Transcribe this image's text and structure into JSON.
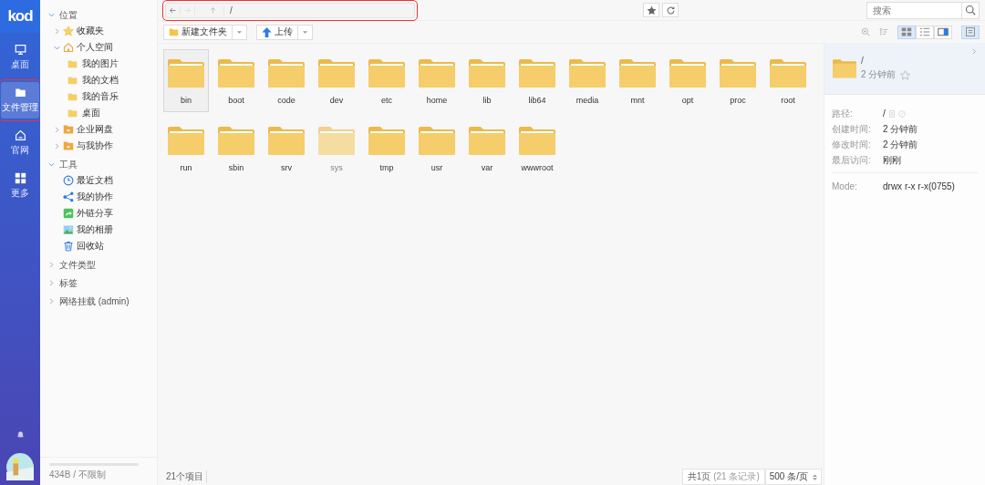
{
  "rail": {
    "logo": "kod",
    "items": [
      {
        "kind": "desktop",
        "label": "桌面",
        "selected": false,
        "highlighted": false
      },
      {
        "kind": "folder",
        "label": "文件管理",
        "selected": true,
        "highlighted": true
      },
      {
        "kind": "home",
        "label": "官网",
        "selected": false,
        "highlighted": false
      },
      {
        "kind": "grid",
        "label": "更多",
        "selected": false,
        "highlighted": false
      }
    ]
  },
  "tree": {
    "sections": [
      {
        "label": "位置",
        "expanded": true,
        "children": [
          {
            "kind": "star",
            "label": "收藏夹",
            "expanded": false
          },
          {
            "kind": "home",
            "label": "个人空间",
            "expanded": true,
            "children": [
              {
                "kind": "folder",
                "label": "我的图片"
              },
              {
                "kind": "folder",
                "label": "我的文档"
              },
              {
                "kind": "folder",
                "label": "我的音乐"
              },
              {
                "kind": "folder",
                "label": "桌面"
              }
            ]
          },
          {
            "kind": "company",
            "label": "企业网盘",
            "expanded": false
          },
          {
            "kind": "shared",
            "label": "与我协作",
            "expanded": false
          }
        ]
      },
      {
        "label": "工具",
        "expanded": true,
        "children": [
          {
            "kind": "clock",
            "label": "最近文档"
          },
          {
            "kind": "share",
            "label": "我的协作"
          },
          {
            "kind": "link",
            "label": "外链分享"
          },
          {
            "kind": "image",
            "label": "我的相册"
          },
          {
            "kind": "trash",
            "label": "回收站"
          }
        ]
      },
      {
        "label": "文件类型",
        "expanded": false
      },
      {
        "label": "标签",
        "expanded": false
      },
      {
        "label": "网络挂载 (admin)",
        "expanded": false
      }
    ],
    "storage": {
      "text": "434B / 不限制",
      "level": 0
    }
  },
  "address_bar": {
    "path": "/",
    "highlighted": true,
    "forward_disabled": true
  },
  "search": {
    "placeholder": "搜索"
  },
  "toolbar": {
    "new_folder": "新建文件夹",
    "upload": "上传",
    "views": [
      {
        "kind": "grid",
        "selected": true
      },
      {
        "kind": "list",
        "selected": false
      },
      {
        "kind": "split",
        "selected": false
      }
    ],
    "panel_open": true
  },
  "files": [
    {
      "name": "bin",
      "selected": true,
      "hidden": false
    },
    {
      "name": "boot",
      "selected": false,
      "hidden": false
    },
    {
      "name": "code",
      "selected": false,
      "hidden": false
    },
    {
      "name": "dev",
      "selected": false,
      "hidden": false
    },
    {
      "name": "etc",
      "selected": false,
      "hidden": false
    },
    {
      "name": "home",
      "selected": false,
      "hidden": false
    },
    {
      "name": "lib",
      "selected": false,
      "hidden": false
    },
    {
      "name": "lib64",
      "selected": false,
      "hidden": false
    },
    {
      "name": "media",
      "selected": false,
      "hidden": false
    },
    {
      "name": "mnt",
      "selected": false,
      "hidden": false
    },
    {
      "name": "opt",
      "selected": false,
      "hidden": false
    },
    {
      "name": "proc",
      "selected": false,
      "hidden": false
    },
    {
      "name": "root",
      "selected": false,
      "hidden": false
    },
    {
      "name": "run",
      "selected": false,
      "hidden": false
    },
    {
      "name": "sbin",
      "selected": false,
      "hidden": false
    },
    {
      "name": "srv",
      "selected": false,
      "hidden": false
    },
    {
      "name": "sys",
      "selected": false,
      "hidden": true
    },
    {
      "name": "tmp",
      "selected": false,
      "hidden": false
    },
    {
      "name": "usr",
      "selected": false,
      "hidden": false
    },
    {
      "name": "var",
      "selected": false,
      "hidden": false
    },
    {
      "name": "wwwroot",
      "selected": false,
      "hidden": false
    }
  ],
  "status_bar": {
    "count": "21个项目",
    "pages": "共1页",
    "records": "(21 条记录)",
    "page_size": "500 条/页"
  },
  "info": {
    "name": "/",
    "time": "2 分钟前",
    "properties": [
      {
        "label": "路径:",
        "value": "/",
        "kind": "path"
      },
      {
        "label": "创建时间:",
        "value": "2 分钟前",
        "kind": "text"
      },
      {
        "label": "修改时间:",
        "value": "2 分钟前",
        "kind": "text"
      },
      {
        "label": "最后访问:",
        "value": "刚刚",
        "kind": "text"
      },
      {
        "label": "Mode:",
        "value": "drwx r-x r-x(0755)",
        "kind": "mode"
      }
    ]
  }
}
